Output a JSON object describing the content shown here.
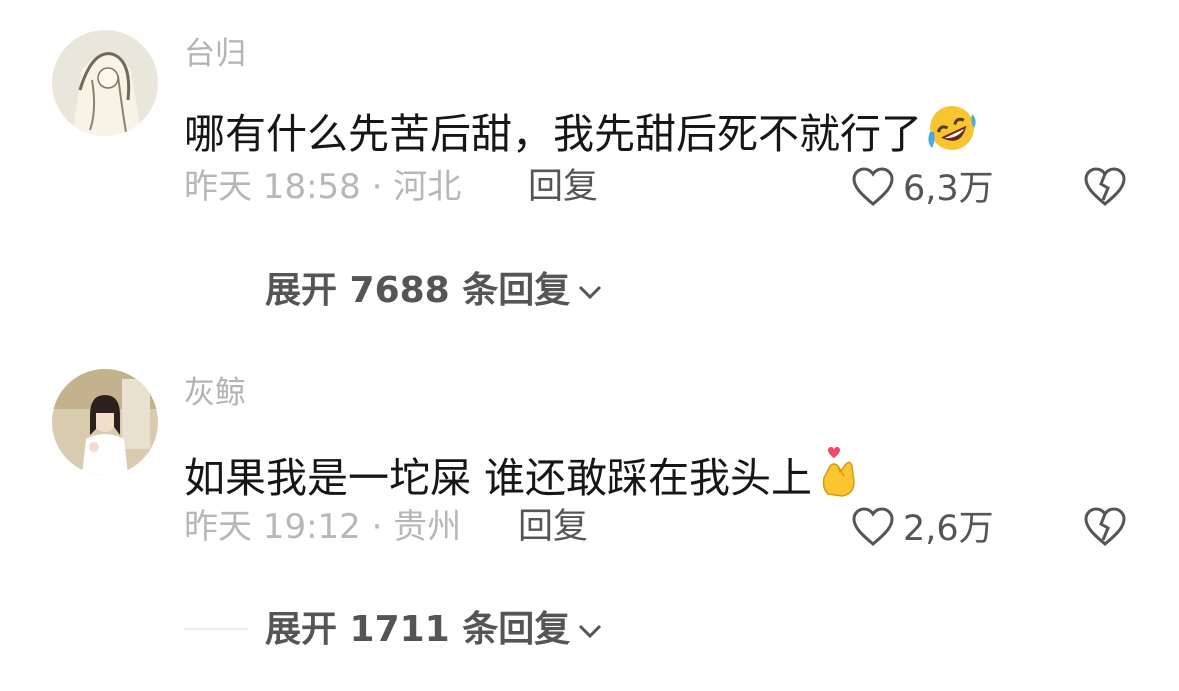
{
  "comments": [
    {
      "username": "台归",
      "text": "哪有什么先苦后甜，我先甜后死不就行了",
      "emoji": "rofl-emoji",
      "meta": "昨天 18:58 · 河北",
      "reply_label": "回复",
      "likes": "6,3万",
      "expand_label": "展开 7688 条回复"
    },
    {
      "username": "灰鲸",
      "text": "如果我是一坨屎 谁还敢踩在我头上",
      "emoji": "finger-heart-emoji",
      "meta": "昨天 19:12 · 贵州",
      "reply_label": "回复",
      "likes": "2,6万",
      "expand_label": "展开 1711 条回复"
    }
  ],
  "icons": {
    "like": "heart-outline-icon",
    "dislike": "broken-heart-icon",
    "expand": "chevron-down-icon"
  },
  "colors": {
    "username": "#b3b3b3",
    "text": "#161616",
    "meta": "#b7b7b7",
    "action": "#555555"
  }
}
